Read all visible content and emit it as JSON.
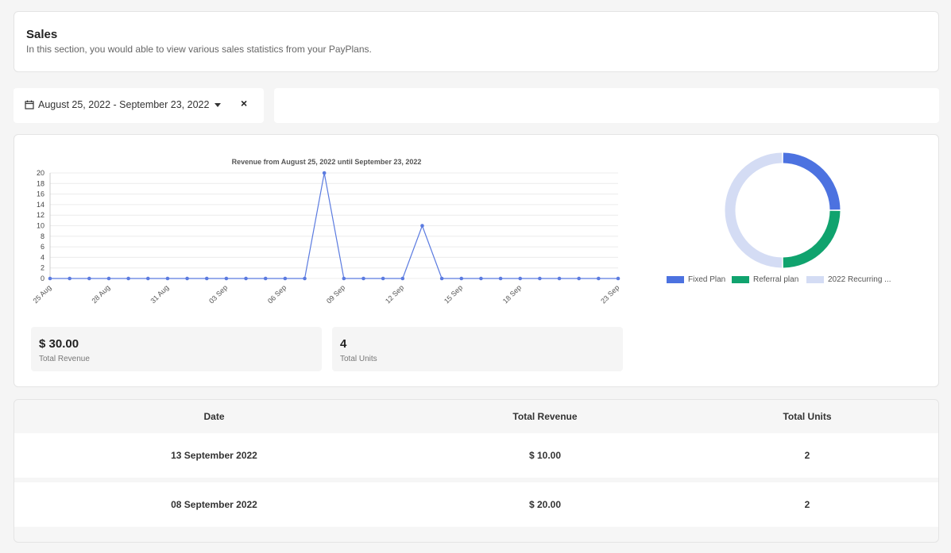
{
  "header": {
    "title": "Sales",
    "subtitle": "In this section, you would able to view various sales statistics from your PayPlans."
  },
  "date_filter": {
    "range": "August 25, 2022 - September 23, 2022",
    "clear_label": "×"
  },
  "stats": {
    "revenue_value": "$ 30.00",
    "revenue_label": "Total Revenue",
    "units_value": "4",
    "units_label": "Total Units"
  },
  "legend": [
    "Fixed Plan",
    "Referral plan",
    "2022 Recurring ..."
  ],
  "table": {
    "headers": [
      "Date",
      "Total Revenue",
      "Total Units"
    ],
    "rows": [
      [
        "13 September 2022",
        "$ 10.00",
        "2"
      ],
      [
        "08 September 2022",
        "$ 20.00",
        "2"
      ]
    ]
  },
  "chart_data": [
    {
      "type": "line",
      "title": "Revenue from August 25, 2022 until September 23, 2022",
      "x": [
        "25 Aug",
        "26 Aug",
        "27 Aug",
        "28 Aug",
        "29 Aug",
        "30 Aug",
        "31 Aug",
        "01 Sep",
        "02 Sep",
        "03 Sep",
        "04 Sep",
        "05 Sep",
        "06 Sep",
        "07 Sep",
        "08 Sep",
        "09 Sep",
        "10 Sep",
        "11 Sep",
        "12 Sep",
        "13 Sep",
        "14 Sep",
        "15 Sep",
        "16 Sep",
        "17 Sep",
        "18 Sep",
        "19 Sep",
        "20 Sep",
        "21 Sep",
        "22 Sep",
        "23 Sep"
      ],
      "x_tick_labels": [
        "25 Aug",
        "28 Aug",
        "31 Aug",
        "03 Sep",
        "06 Sep",
        "09 Sep",
        "12 Sep",
        "15 Sep",
        "18 Sep",
        "23 Sep"
      ],
      "values": [
        0,
        0,
        0,
        0,
        0,
        0,
        0,
        0,
        0,
        0,
        0,
        0,
        0,
        0,
        20,
        0,
        0,
        0,
        0,
        10,
        0,
        0,
        0,
        0,
        0,
        0,
        0,
        0,
        0,
        0
      ],
      "ylim": [
        0,
        20
      ],
      "yticks": [
        0,
        2,
        4,
        6,
        8,
        10,
        12,
        14,
        16,
        18,
        20
      ],
      "grid": true,
      "color": "#5b7be0"
    },
    {
      "type": "pie",
      "variant": "donut",
      "categories": [
        "Fixed Plan",
        "Referral plan",
        "2022 Recurring ..."
      ],
      "values": [
        1,
        1,
        2
      ],
      "colors": [
        "#4c72e0",
        "#10a36e",
        "#d4dcf4"
      ],
      "legend": "bottom"
    }
  ]
}
